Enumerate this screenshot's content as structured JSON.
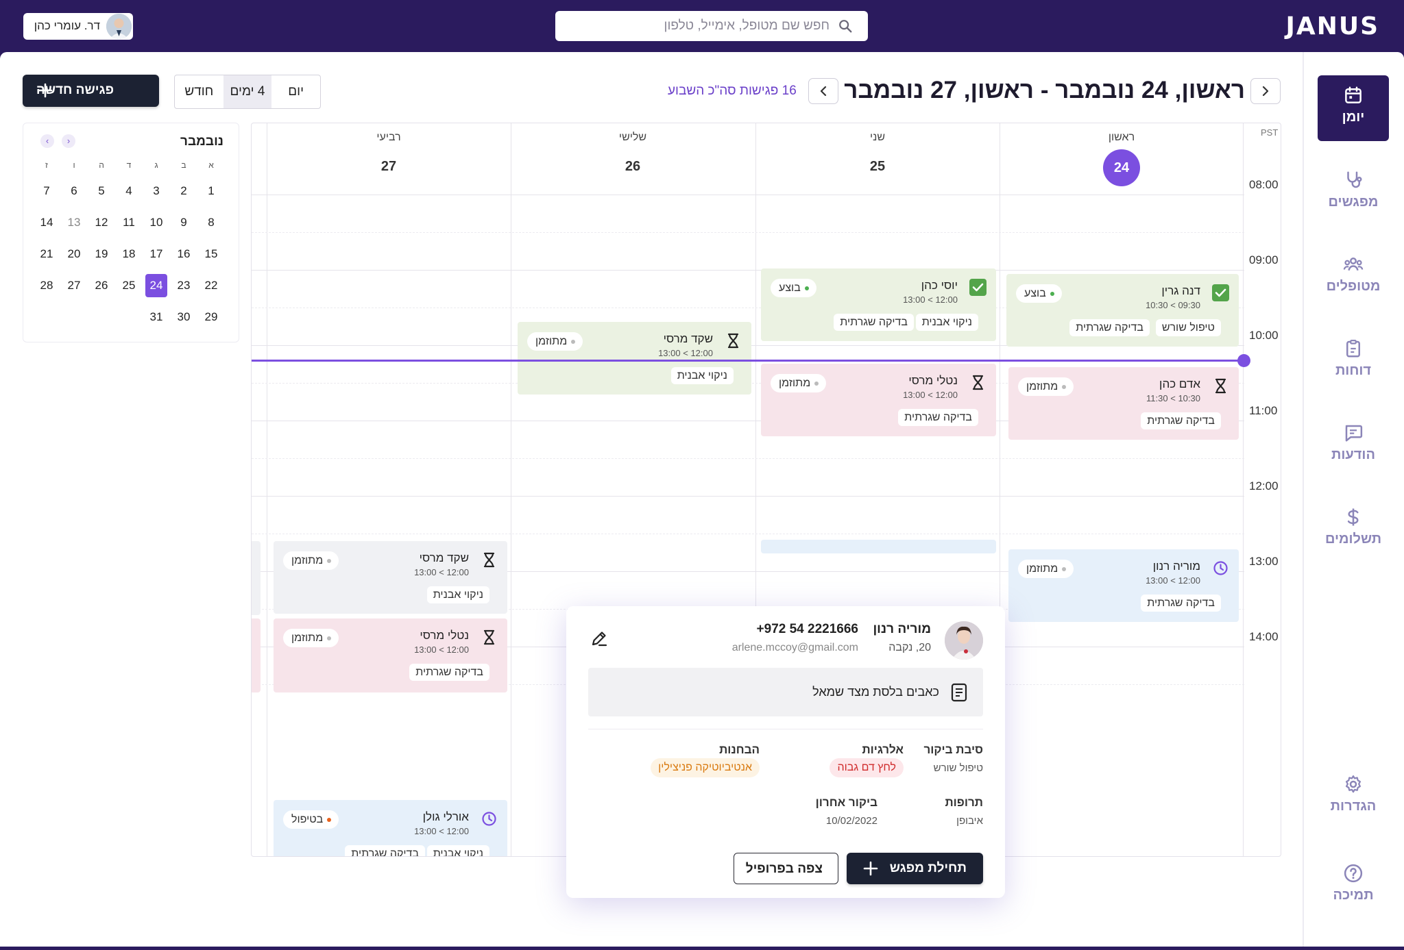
{
  "brand": {
    "logo": "JANUS"
  },
  "search": {
    "placeholder": "חפש שם מטופל, אימייל, טלפון"
  },
  "user": {
    "name": "דר. עומרי כהן"
  },
  "nav": {
    "items": [
      {
        "label": "יומן",
        "icon": "calendar-icon",
        "active": true
      },
      {
        "label": "מפגשים",
        "icon": "stethoscope-icon"
      },
      {
        "label": "מטופלים",
        "icon": "users-icon"
      },
      {
        "label": "דוחות",
        "icon": "clipboard-icon"
      },
      {
        "label": "הודעות",
        "icon": "message-icon"
      },
      {
        "label": "תשלומים",
        "icon": "dollar-icon"
      }
    ],
    "bottom": [
      {
        "label": "הגדרות",
        "icon": "gear-icon"
      },
      {
        "label": "תמיכה",
        "icon": "help-icon"
      }
    ]
  },
  "header": {
    "date_range": "ראשון, 24 נובמבר  - ראשון, 27 נובמבר",
    "meetings_count": "16 פגישות סה\"כ השבוע",
    "views": [
      "יום",
      "4 ימים",
      "חודש"
    ],
    "selected_view": "4 ימים",
    "new_meeting": "פגישה חדשה"
  },
  "mini_calendar": {
    "month": "נובמבר",
    "weekdays": [
      "א",
      "ב",
      "ג",
      "ד",
      "ה",
      "ו",
      "ז"
    ],
    "weeks": [
      [
        "1",
        "2",
        "3",
        "4",
        "5",
        "6",
        "7"
      ],
      [
        "8",
        "9",
        "10",
        "11",
        "12",
        "13",
        "14"
      ],
      [
        "15",
        "16",
        "17",
        "18",
        "19",
        "20",
        "21"
      ],
      [
        "22",
        "23",
        "24",
        "25",
        "26",
        "27",
        "28"
      ],
      [
        "29",
        "30",
        "31",
        "",
        "",
        "",
        ""
      ]
    ],
    "selected": "24"
  },
  "week": {
    "timezone": "PST",
    "hours": [
      "08:00",
      "09:00",
      "10:00",
      "11:00",
      "12:00",
      "13:00",
      "14:00"
    ],
    "days": [
      {
        "name": "ראשון",
        "num": "24",
        "today": true
      },
      {
        "name": "שני",
        "num": "25"
      },
      {
        "name": "שלישי",
        "num": "26"
      },
      {
        "name": "רביעי",
        "num": "27"
      }
    ]
  },
  "events": {
    "dana": {
      "name": "דנה גרין",
      "time": "09:30 > 10:30",
      "status": "בוצע",
      "tags": [
        "טיפול שורש",
        "בדיקה שגרתית"
      ]
    },
    "adam": {
      "name": "אדם כהן",
      "time": "10:30 > 11:30",
      "status": "מתוזמן",
      "tags": [
        "בדיקה שגרתית"
      ]
    },
    "moria": {
      "name": "מוריה רנון",
      "time": "12:00 > 13:00",
      "status": "מתוזמן",
      "tags": [
        "בדיקה שגרתית"
      ]
    },
    "yossi": {
      "name": "יוסי כהן",
      "time": "12:00 > 13:00",
      "status": "בוצע",
      "tags": [
        "ניקוי אבנית",
        "בדיקה שגרתית"
      ]
    },
    "natali1": {
      "name": "נטלי מרסי",
      "time": "12:00 > 13:00",
      "status": "מתוזמן",
      "tags": [
        "בדיקה שגרתית"
      ]
    },
    "shaked1": {
      "name": "שקד מרסי",
      "time": "12:00 > 13:00",
      "status": "מתוזמן",
      "tags": [
        "ניקוי אבנית"
      ]
    },
    "shaked2": {
      "name": "שקד מרסי",
      "time": "12:00 > 13:00",
      "status": "מתוזמן",
      "tags": [
        "ניקוי אבנית"
      ]
    },
    "natali2": {
      "name": "נטלי מרסי",
      "time": "12:00 > 13:00",
      "status": "מתוזמן",
      "tags": [
        "בדיקה שגרתית"
      ]
    },
    "orli": {
      "name": "אורלי גולן",
      "time": "12:00 > 13:00",
      "status": "בטיפול",
      "tags": [
        "ניקוי אבנית",
        "בדיקה שגרתית"
      ]
    }
  },
  "popup": {
    "name": "מוריה רנון",
    "phone": "+972 54 2221666",
    "sub": "20, נקבה",
    "email": "arlene.mccoy@gmail.com",
    "note": "כאבים בלסת מצד שמאל",
    "reason_label": "סיבת ביקור",
    "reason_value": "טיפול שורש",
    "allergies_label": "אלרגיות",
    "allergies_value": "לחץ דם גבוה",
    "diagnoses_label": "הבחנות",
    "diagnoses_value": "אנטיביוטיקה פניצילין",
    "meds_label": "תרופות",
    "meds_value": "איבופן",
    "last_visit_label": "ביקור אחרון",
    "last_visit_value": "10/02/2022",
    "start_button": "תחילת מפגש",
    "profile_button": "צפה בפרופיל"
  },
  "colors": {
    "brand": "#2b1b5e",
    "accent": "#7b4fe0",
    "done_green": "#4caf50",
    "in_treatment": "#e8621c"
  }
}
